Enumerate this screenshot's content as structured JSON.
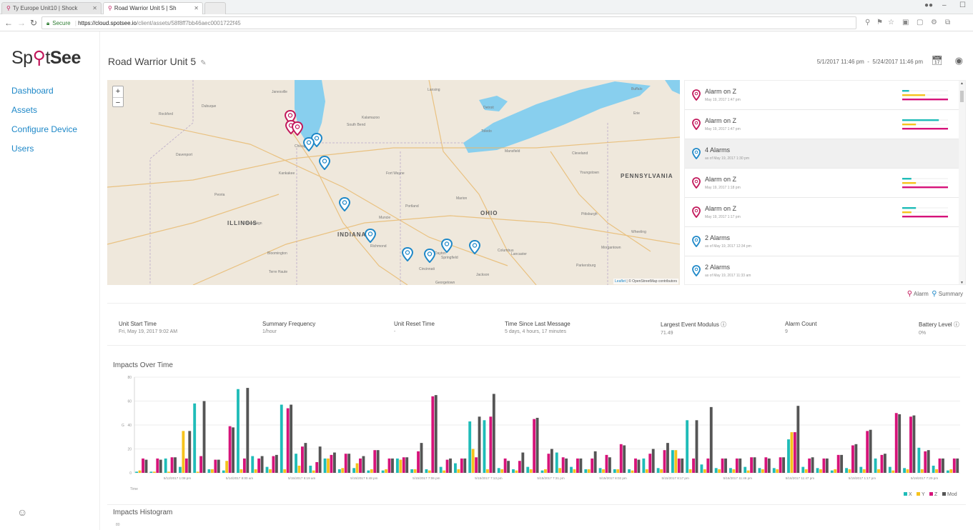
{
  "browser": {
    "tabs": [
      {
        "label": "Ty Europe Unit10 | Shock"
      },
      {
        "label": "Road Warrior Unit 5 | Sh"
      }
    ],
    "secure_label": "Secure",
    "url_host": "https://cloud.spotsee.io",
    "url_path": "/client/assets/58f8ff7bb46aec0001722f45"
  },
  "sidebar": {
    "logo_spot": "Sp",
    "logo_t": "t",
    "logo_see": "See",
    "items": [
      {
        "label": "Dashboard"
      },
      {
        "label": "Assets"
      },
      {
        "label": "Configure Device"
      },
      {
        "label": "Users"
      }
    ]
  },
  "header": {
    "title": "Road Warrior Unit 5",
    "date_start": "5/1/2017 11:46 pm",
    "date_sep": "-",
    "date_end": "5/24/2017 11:46 pm"
  },
  "map": {
    "zoom_in": "+",
    "zoom_out": "−",
    "labels": [
      {
        "text": "ILLINOIS",
        "kind": "state"
      },
      {
        "text": "INDIANA",
        "kind": "state"
      },
      {
        "text": "OHIO",
        "kind": "state"
      },
      {
        "text": "PENNSYLVANIA",
        "kind": "state"
      },
      {
        "text": "Detroit",
        "kind": "city"
      },
      {
        "text": "Cleveland",
        "kind": "city"
      },
      {
        "text": "Toledo",
        "kind": "city"
      },
      {
        "text": "Chicago",
        "kind": "city"
      },
      {
        "text": "Cincinnati",
        "kind": "city"
      },
      {
        "text": "Pittsburgh",
        "kind": "city"
      },
      {
        "text": "Columbus",
        "kind": "city"
      },
      {
        "text": "Rockford",
        "kind": "city"
      },
      {
        "text": "South Bend",
        "kind": "city"
      },
      {
        "text": "Fort Wayne",
        "kind": "city"
      },
      {
        "text": "Dayton",
        "kind": "city"
      },
      {
        "text": "Springfield",
        "kind": "city"
      },
      {
        "text": "Lancaster",
        "kind": "city"
      },
      {
        "text": "Champaign",
        "kind": "city"
      },
      {
        "text": "Peoria",
        "kind": "city"
      },
      {
        "text": "Kankakee",
        "kind": "city"
      },
      {
        "text": "Richmond",
        "kind": "city"
      },
      {
        "text": "Mansfield",
        "kind": "city"
      },
      {
        "text": "Youngstown",
        "kind": "city"
      },
      {
        "text": "Erie",
        "kind": "city"
      },
      {
        "text": "Buffalo",
        "kind": "city"
      },
      {
        "text": "Lansing",
        "kind": "city"
      },
      {
        "text": "Kalamazoo",
        "kind": "city"
      },
      {
        "text": "Janesville",
        "kind": "city"
      },
      {
        "text": "Dubuque",
        "kind": "city"
      },
      {
        "text": "Davenport",
        "kind": "city"
      },
      {
        "text": "Terre Haute",
        "kind": "city"
      },
      {
        "text": "Bloomington",
        "kind": "city"
      },
      {
        "text": "Marion",
        "kind": "city"
      },
      {
        "text": "Muncie",
        "kind": "city"
      },
      {
        "text": "Portland",
        "kind": "city"
      },
      {
        "text": "Wheeling",
        "kind": "city"
      },
      {
        "text": "Parkersburg",
        "kind": "city"
      },
      {
        "text": "Morgantown",
        "kind": "city"
      },
      {
        "text": "Jackson",
        "kind": "city"
      },
      {
        "text": "Georgetown",
        "kind": "city"
      }
    ],
    "attribution_leaflet": "Leaflet",
    "attribution_rest": " | © OpenStreetMap contributors",
    "pins": [
      {
        "type": "alarm"
      },
      {
        "type": "alarm"
      },
      {
        "type": "alarm"
      },
      {
        "type": "summary"
      },
      {
        "type": "summary"
      },
      {
        "type": "summary"
      },
      {
        "type": "summary"
      },
      {
        "type": "summary"
      },
      {
        "type": "summary"
      },
      {
        "type": "summary"
      },
      {
        "type": "summary"
      },
      {
        "type": "summary"
      }
    ]
  },
  "feed": {
    "items": [
      {
        "title": "Alarm on Z",
        "sub": "May 19, 2017 1:47 pm",
        "type": "alarm",
        "bars": [
          0.15,
          0.5,
          1.0
        ]
      },
      {
        "title": "Alarm on Z",
        "sub": "May 19, 2017 1:47 pm",
        "type": "alarm",
        "bars": [
          0.8,
          0.3,
          1.0
        ]
      },
      {
        "title": "4 Alarms",
        "sub": "as of May 19, 2017 1:30 pm",
        "type": "summary",
        "bars": []
      },
      {
        "title": "Alarm on Z",
        "sub": "May 19, 2017 1:18 pm",
        "type": "alarm",
        "bars": [
          0.2,
          0.3,
          1.0
        ]
      },
      {
        "title": "Alarm on Z",
        "sub": "May 19, 2017 1:17 pm",
        "type": "alarm",
        "bars": [
          0.3,
          0.2,
          1.0
        ]
      },
      {
        "title": "2 Alarms",
        "sub": "as of May 19, 2017 12:34 pm",
        "type": "summary",
        "bars": []
      },
      {
        "title": "2 Alarms",
        "sub": "as of May 19, 2017 11:33 am",
        "type": "summary",
        "bars": []
      }
    ]
  },
  "legend": {
    "alarm": "Alarm",
    "summary": "Summary"
  },
  "stats": [
    {
      "label": "Unit Start Time",
      "value": "Fri, May 19, 2017 9:02 AM"
    },
    {
      "label": "Summary Frequency",
      "value": "1/hour"
    },
    {
      "label": "Unit Reset Time",
      "value": "-"
    },
    {
      "label": "Time Since Last Message",
      "value": "5 days, 4 hours, 17 minutes"
    },
    {
      "label": "Largest Event Modulus ⓘ",
      "value": "71.49"
    },
    {
      "label": "Alarm Count",
      "value": "9"
    },
    {
      "label": "Battery Level ⓘ",
      "value": "0%"
    }
  ],
  "sections": {
    "impacts_over_time": "Impacts Over Time",
    "impacts_histogram": "Impacts Histogram"
  },
  "colors": {
    "x": "#1fbcb8",
    "y": "#f6c21c",
    "z": "#d6137a",
    "mod": "#555555",
    "alarm": "#c2185b",
    "summary": "#1e88c8",
    "link": "#1e88c8"
  },
  "chart_data": {
    "type": "bar",
    "title": "Impacts Over Time",
    "xlabel": "Time",
    "ylabel": "G",
    "ylim": [
      0,
      80
    ],
    "yticks": [
      0,
      20,
      40,
      60,
      80
    ],
    "grid": true,
    "legend_position": "bottom-right",
    "tick_labels": [
      "5/12/2017 1:08 pm",
      "5/14/2017 8:00 am",
      "5/15/2017 6:19 am",
      "5/15/2017 5:48 pm",
      "5/15/2017 7:06 pm",
      "5/15/2017 7:13 pm",
      "5/15/2017 7:31 pm",
      "5/15/2017 8:02 pm",
      "5/15/2017 8:17 pm",
      "5/16/2017 11:46 pm",
      "5/16/2017 11:47 pm",
      "5/19/2017 1:17 pm",
      "5/19/2017 7:29 pm"
    ],
    "series": [
      {
        "name": "X",
        "values": [
          1,
          1,
          12,
          5,
          58,
          3,
          2,
          70,
          14,
          5,
          57,
          16,
          6,
          12,
          3,
          4,
          2,
          2,
          12,
          3,
          3,
          5,
          8,
          43,
          44,
          4,
          3,
          5,
          2,
          17,
          5,
          3,
          4,
          3,
          3,
          12,
          4,
          19,
          44,
          7,
          4,
          4,
          5,
          4,
          4,
          28,
          5,
          4,
          2,
          4,
          5,
          12,
          5,
          4,
          21,
          6,
          2
        ]
      },
      {
        "name": "Y",
        "values": [
          2,
          1,
          1,
          35,
          1,
          3,
          10,
          3,
          3,
          3,
          3,
          6,
          2,
          12,
          4,
          8,
          3,
          3,
          11,
          3,
          2,
          2,
          3,
          20,
          3,
          3,
          2,
          3,
          3,
          4,
          3,
          3,
          3,
          3,
          2,
          3,
          3,
          19,
          3,
          3,
          3,
          3,
          2,
          3,
          3,
          34,
          3,
          3,
          3,
          3,
          3,
          3,
          2,
          3,
          3,
          3,
          3
        ]
      },
      {
        "name": "Z",
        "values": [
          12,
          12,
          13,
          12,
          14,
          11,
          39,
          12,
          12,
          14,
          54,
          22,
          9,
          15,
          16,
          12,
          19,
          12,
          13,
          18,
          64,
          11,
          12,
          13,
          47,
          12,
          10,
          45,
          16,
          13,
          12,
          12,
          15,
          24,
          12,
          16,
          19,
          12,
          12,
          12,
          12,
          12,
          13,
          13,
          13,
          34,
          12,
          12,
          15,
          23,
          35,
          15,
          50,
          47,
          18,
          12,
          12
        ]
      },
      {
        "name": "Mod",
        "values": [
          11,
          11,
          13,
          35,
          60,
          11,
          38,
          71,
          14,
          15,
          57,
          25,
          22,
          17,
          16,
          14,
          19,
          12,
          13,
          25,
          65,
          12,
          12,
          47,
          66,
          10,
          17,
          46,
          20,
          12,
          12,
          18,
          13,
          23,
          11,
          20,
          25,
          12,
          44,
          55,
          12,
          12,
          13,
          12,
          13,
          56,
          13,
          12,
          15,
          24,
          36,
          16,
          49,
          48,
          19,
          12,
          12
        ]
      }
    ]
  }
}
